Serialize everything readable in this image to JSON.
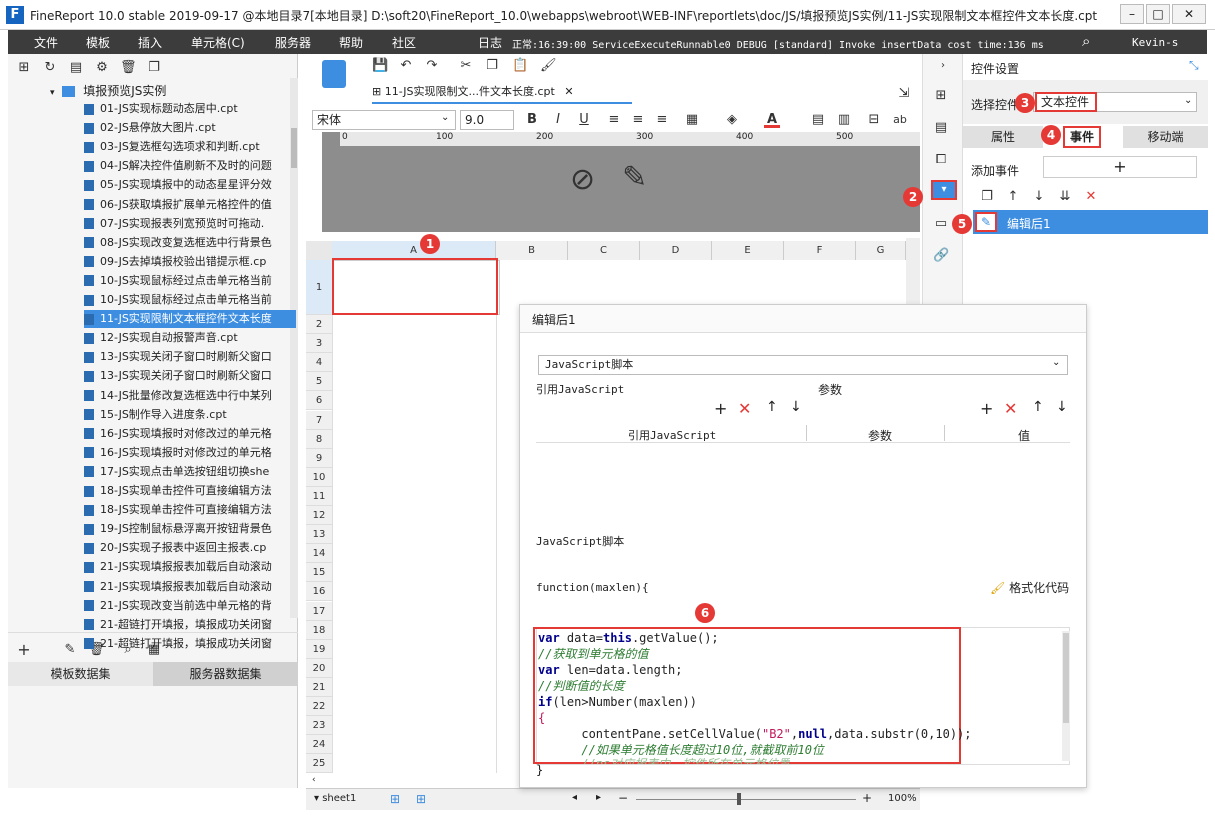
{
  "titlebar": {
    "title": "FineReport 10.0 stable 2019-09-17 @本地目录7[本地目录]    D:\\soft20\\FineReport_10.0\\webapps\\webroot\\WEB-INF\\reportlets\\doc/JS/填报预览JS实例/11-JS实现限制文本框控件文本长度.cpt",
    "logo": "F"
  },
  "menu": {
    "items": [
      "文件",
      "模板",
      "插入",
      "单元格(C)",
      "服务器",
      "帮助",
      "社区"
    ],
    "log_label": "日志",
    "log_text": "正常:16:39:00 ServiceExecuteRunnable0 DEBUG [standard] Invoke insertData cost time:136 ms",
    "user": "Kevin-s"
  },
  "tree": {
    "folder": "填报预览JS实例",
    "items": [
      "01-JS实现标题动态居中.cpt",
      "02-JS悬停放大图片.cpt",
      "03-JS复选框勾选项求和判断.cpt",
      "04-JS解决控件值刷新不及时的问题",
      "05-JS实现填报中的动态星星评分效",
      "06-JS获取填报扩展单元格控件的值",
      "07-JS实现报表列宽预览时可拖动.",
      "08-JS实现改变复选框选中行背景色",
      "09-JS去掉填报校验出错提示框.cp",
      "10-JS实现鼠标经过点击单元格当前",
      "10-JS实现鼠标经过点击单元格当前",
      "11-JS实现限制文本框控件文本长度",
      "12-JS实现自动报警声音.cpt",
      "13-JS实现关闭子窗口时刷新父窗口",
      "13-JS实现关闭子窗口时刷新父窗口",
      "14-JS批量修改复选框选中行中某列",
      "15-JS制作导入进度条.cpt",
      "16-JS实现填报时对修改过的单元格",
      "16-JS实现填报时对修改过的单元格",
      "17-JS实现点击单选按钮组切换she",
      "18-JS实现单击控件可直接编辑方法",
      "18-JS实现单击控件可直接编辑方法",
      "19-JS控制鼠标悬浮离开按钮背景色",
      "20-JS实现子报表中返回主报表.cp",
      "21-JS实现填报报表加载后自动滚动",
      "21-JS实现填报报表加载后自动滚动",
      "21-JS实现改变当前选中单元格的背",
      "21-超链打开填报，填报成功关闭窗",
      "21-超链打开填报，填报成功关闭窗"
    ],
    "selected_index": 11
  },
  "datasets": {
    "tab1": "模板数据集",
    "tab2": "服务器数据集"
  },
  "tab": {
    "label": "11-JS实现限制文...件文本长度.cpt"
  },
  "format": {
    "font": "宋体",
    "size": "9.0"
  },
  "ruler": {
    "marks": [
      "0",
      "100",
      "200",
      "300",
      "400",
      "500"
    ]
  },
  "grid": {
    "columns": [
      "A",
      "B",
      "C",
      "D",
      "E",
      "F",
      "G"
    ],
    "rows": [
      "1",
      "2",
      "3",
      "4",
      "5",
      "6",
      "7",
      "8",
      "9",
      "10",
      "11",
      "12",
      "13",
      "14",
      "15",
      "16",
      "17",
      "18",
      "19",
      "20",
      "21",
      "22",
      "23",
      "24",
      "25"
    ]
  },
  "sheet": {
    "name": "sheet1",
    "zoom": "100%"
  },
  "rightpanel": {
    "title": "控件设置",
    "select_label": "选择控件",
    "select_value": "文本控件",
    "tabs": [
      "属性",
      "事件",
      "移动端"
    ],
    "add_event": "添加事件",
    "event_item": "编辑后1"
  },
  "dialog": {
    "title": "编辑后1",
    "type": "JavaScript脚本",
    "ref_js": "引用JavaScript",
    "params": "参数",
    "col_ref": "引用JavaScript",
    "col_param": "参数",
    "col_value": "值",
    "script_label": "JavaScript脚本",
    "func_sig": "function(maxlen){",
    "format_code": "格式化代码",
    "closing": "}"
  },
  "code": {
    "l1a": "var",
    "l1b": " data=",
    "l1c": "this",
    "l1d": ".getValue();",
    "l2": "//获取到单元格的值",
    "l3a": "var",
    "l3b": " len=data.length;",
    "l4": "//判断值的长度",
    "l5a": "if",
    "l5b": "(len>Number(maxlen))",
    "l6": "{",
    "l7a": "      contentPane.setCellValue(",
    "l7b": "\"B2\"",
    "l7c": ",",
    "l7d": "null",
    "l7e": ",data.substr(0,10));",
    "l8": "      //如果单元格值长度超过10位,就截取前10位",
    "l9": "      //ps对应报表中，控件所在单元格位置"
  },
  "badges": [
    "1",
    "2",
    "3",
    "4",
    "5",
    "6"
  ],
  "colors": {
    "accent": "#3d8ee0",
    "badge": "#e53935",
    "menubar": "#3c3c3c"
  }
}
